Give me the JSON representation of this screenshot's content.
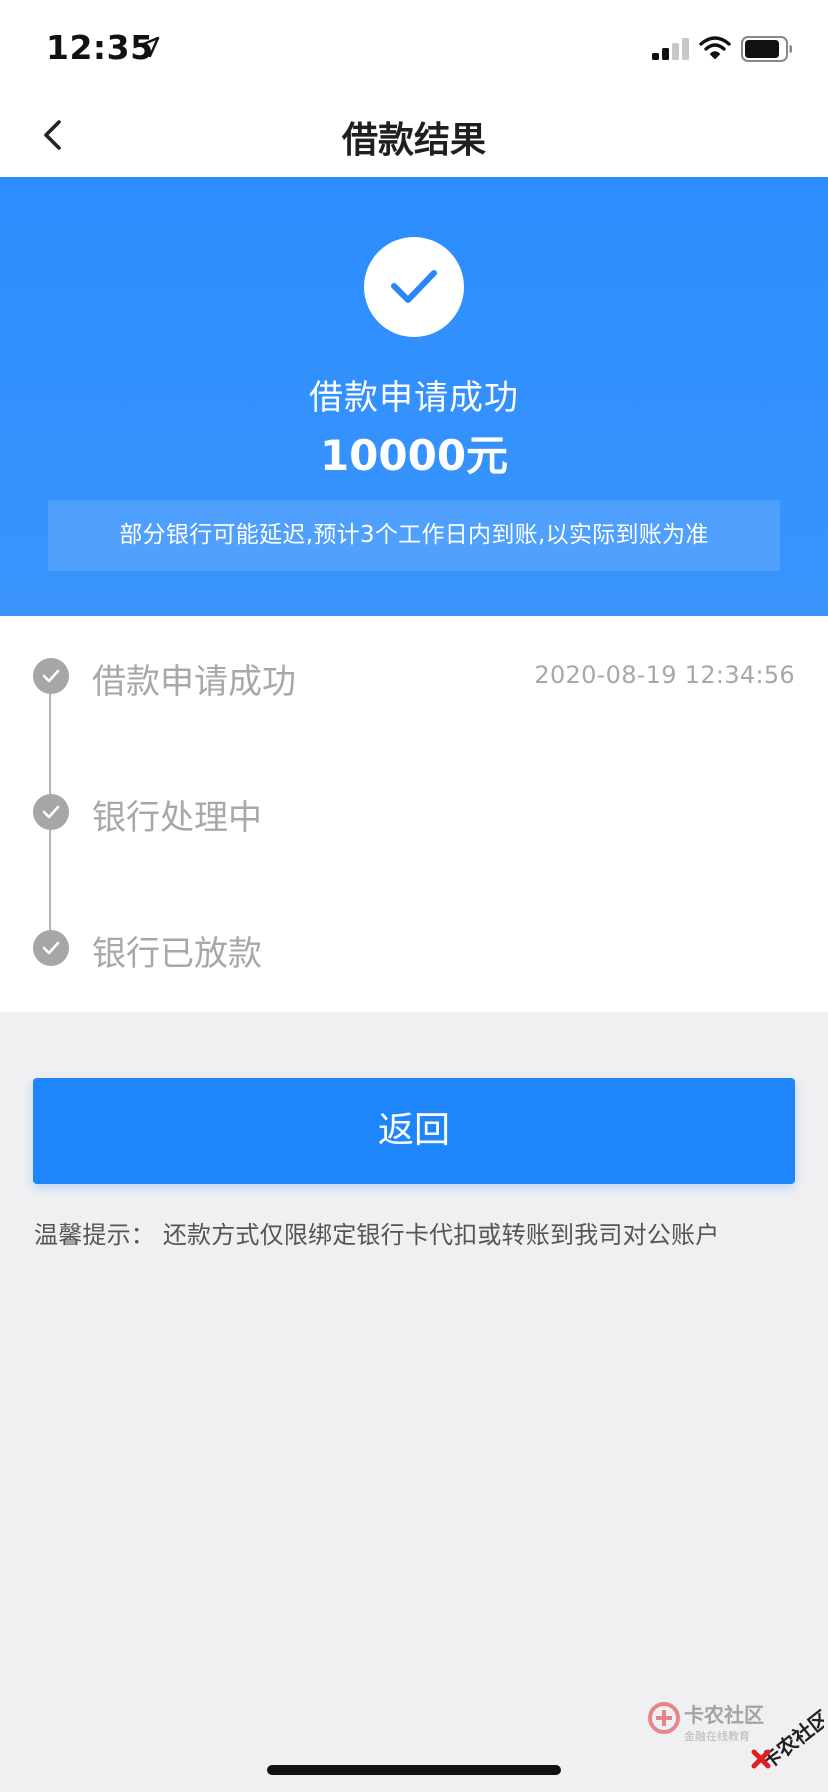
{
  "status_bar": {
    "time": "12:35",
    "location_icon": "location-arrow-icon",
    "signal_icon": "cellular-signal-icon",
    "wifi_icon": "wifi-icon",
    "battery_icon": "battery-icon"
  },
  "nav": {
    "back_icon": "chevron-left-icon",
    "title": "借款结果"
  },
  "banner": {
    "status_icon": "checkmark-icon",
    "status_text": "借款申请成功",
    "amount": "10000元",
    "notice": "部分银行可能延迟,预计3个工作日内到账,以实际到账为准"
  },
  "timeline": {
    "steps": [
      {
        "label": "借款申请成功",
        "time": "2020-08-19 12:34:56"
      },
      {
        "label": "银行处理中",
        "time": ""
      },
      {
        "label": "银行已放款",
        "time": ""
      }
    ]
  },
  "actions": {
    "return_label": "返回"
  },
  "tip": {
    "text": "温馨提示：  还款方式仅限绑定银行卡代扣或转账到我司对公账户"
  },
  "watermark": {
    "brand_text": "卡农社区",
    "slogan": "金融在线教育"
  },
  "colors": {
    "primary": "#1f85fb",
    "banner": "#2c8dff",
    "step_gray": "#a6a6a6",
    "page_bg": "#f0f0f2"
  }
}
